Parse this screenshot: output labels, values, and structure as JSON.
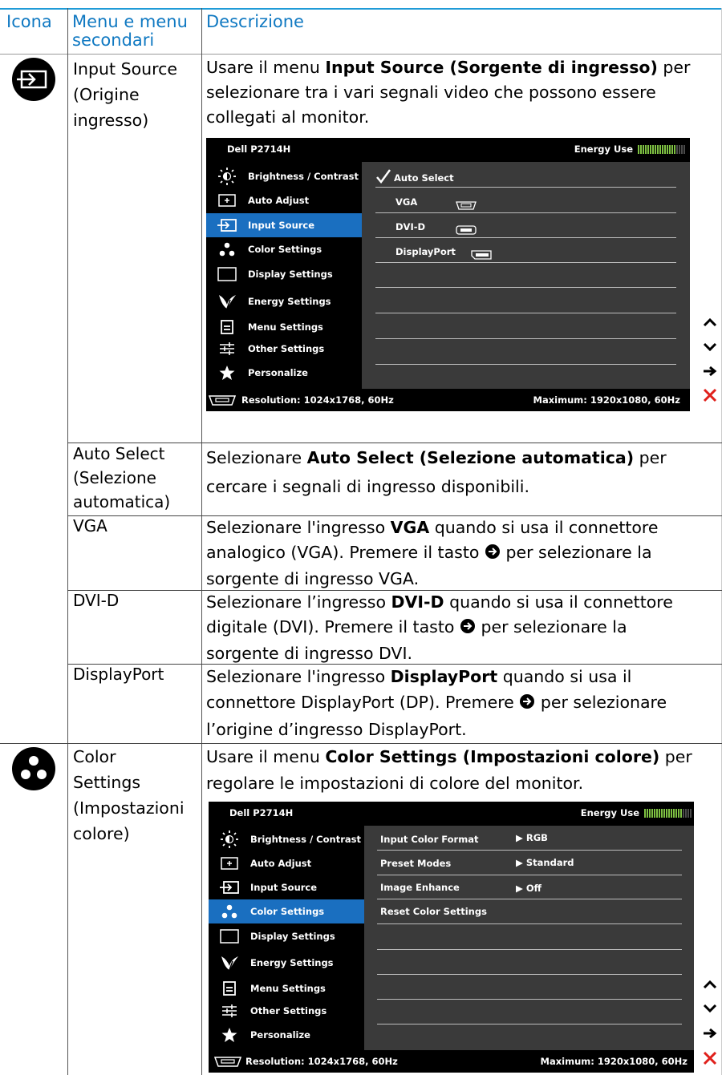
{
  "header": {
    "col1": "Icona",
    "col2a": "Menu e menu",
    "col2b": "secondari",
    "col3": "Descrizione"
  },
  "rows": {
    "input_source": {
      "name_lines": [
        "Input Source",
        "(Origine",
        "ingresso)"
      ],
      "desc_pre": "Usare il menu ",
      "desc_bold": "Input Source (Sorgente di ingresso)",
      "desc_lines": [
        " per",
        "selezionare tra i vari segnali video che possono essere",
        "collegati al monitor."
      ]
    },
    "auto_select": {
      "name_lines": [
        "Auto Select",
        "(Selezione",
        "automatica)"
      ],
      "desc_pre": "Selezionare ",
      "desc_bold": "Auto Select (Selezione automatica)",
      "desc_post": " per",
      "desc_line2": "cercare i segnali di ingresso disponibili."
    },
    "vga": {
      "name": "VGA",
      "desc_pre": "Selezionare l'ingresso ",
      "desc_bold": "VGA",
      "desc_post": " quando si usa il connettore",
      "desc_line2_pre": "analogico (VGA). Premere il tasto ",
      "desc_line2_post": " per selezionare la",
      "desc_line3": "sorgente di ingresso VGA."
    },
    "dvi": {
      "name": "DVI-D",
      "desc_pre": "Selezionare l’ingresso ",
      "desc_bold": "DVI-D",
      "desc_post": " quando si usa il connettore",
      "desc_line2_pre": "digitale (DVI). Premere il tasto ",
      "desc_line2_post": " per selezionare la",
      "desc_line3": "sorgente di ingresso DVI."
    },
    "displayport": {
      "name": "DisplayPort",
      "desc_pre": "Selezionare l'ingresso ",
      "desc_bold": "DisplayPort",
      "desc_post": " quando si usa il",
      "desc_line2_pre": "connettore DisplayPort (DP). Premere ",
      "desc_line2_post": " per selezionare",
      "desc_line3": "l’origine d’ingresso DisplayPort."
    },
    "color_settings": {
      "name_lines": [
        "Color",
        "Settings",
        "(Impostazioni",
        "colore)"
      ],
      "desc_pre": "Usare il menu ",
      "desc_bold": "Color Settings (Impostazioni colore)",
      "desc_post": " per",
      "desc_line2": "regolare le impostazioni di colore del monitor."
    }
  },
  "osd": {
    "model": "Dell P2714H",
    "energy_label": "Energy Use",
    "menu": [
      "Brightness / Contrast",
      "Auto Adjust",
      "Input Source",
      "Color Settings",
      "Display Settings",
      "Energy Settings",
      "Menu Settings",
      "Other Settings",
      "Personalize"
    ],
    "resolution": "Resolution: 1024x1768, 60Hz",
    "maximum": "Maximum: 1920x1080, 60Hz",
    "input_options": [
      "Auto Select",
      "VGA",
      "DVI-D",
      "DisplayPort"
    ],
    "color_options": [
      {
        "label": "Input Color Format",
        "value": "RGB"
      },
      {
        "label": "Preset Modes",
        "value": "Standard"
      },
      {
        "label": "Image Enhance",
        "value": "Off"
      },
      {
        "label": "Reset Color Settings",
        "value": ""
      }
    ]
  },
  "colors": {
    "header_text": "#1079c2",
    "rule": "#1f9bd7",
    "osd_selected": "#1a6fc0",
    "energy_bar": "#7ec142",
    "close_x": "#e0201b"
  }
}
